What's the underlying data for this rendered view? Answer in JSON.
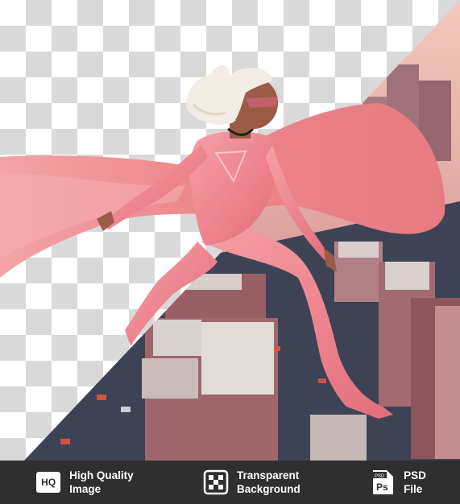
{
  "image": {
    "subject": "3d-superheroine-in-pink-flying-over-city",
    "colors": {
      "suit": "#f2858f",
      "cape": "#ef8b8f",
      "hair": "#f3ece4",
      "skin": "#9b5b45",
      "city_dark": "#3d4354",
      "building": "#a86b70",
      "sky": "#f2c0b3",
      "checker": "#d9d9d9"
    }
  },
  "footer": {
    "items": [
      {
        "icon": "hq-icon",
        "badge": "HQ",
        "line1": "High Quality",
        "line2": "Image"
      },
      {
        "icon": "transparent-background-icon",
        "line1": "Transparent",
        "line2": "Background"
      },
      {
        "icon": "psd-file-icon",
        "badge_top": "PSD",
        "badge": "Ps",
        "line1": "PSD",
        "line2": "File"
      }
    ]
  }
}
